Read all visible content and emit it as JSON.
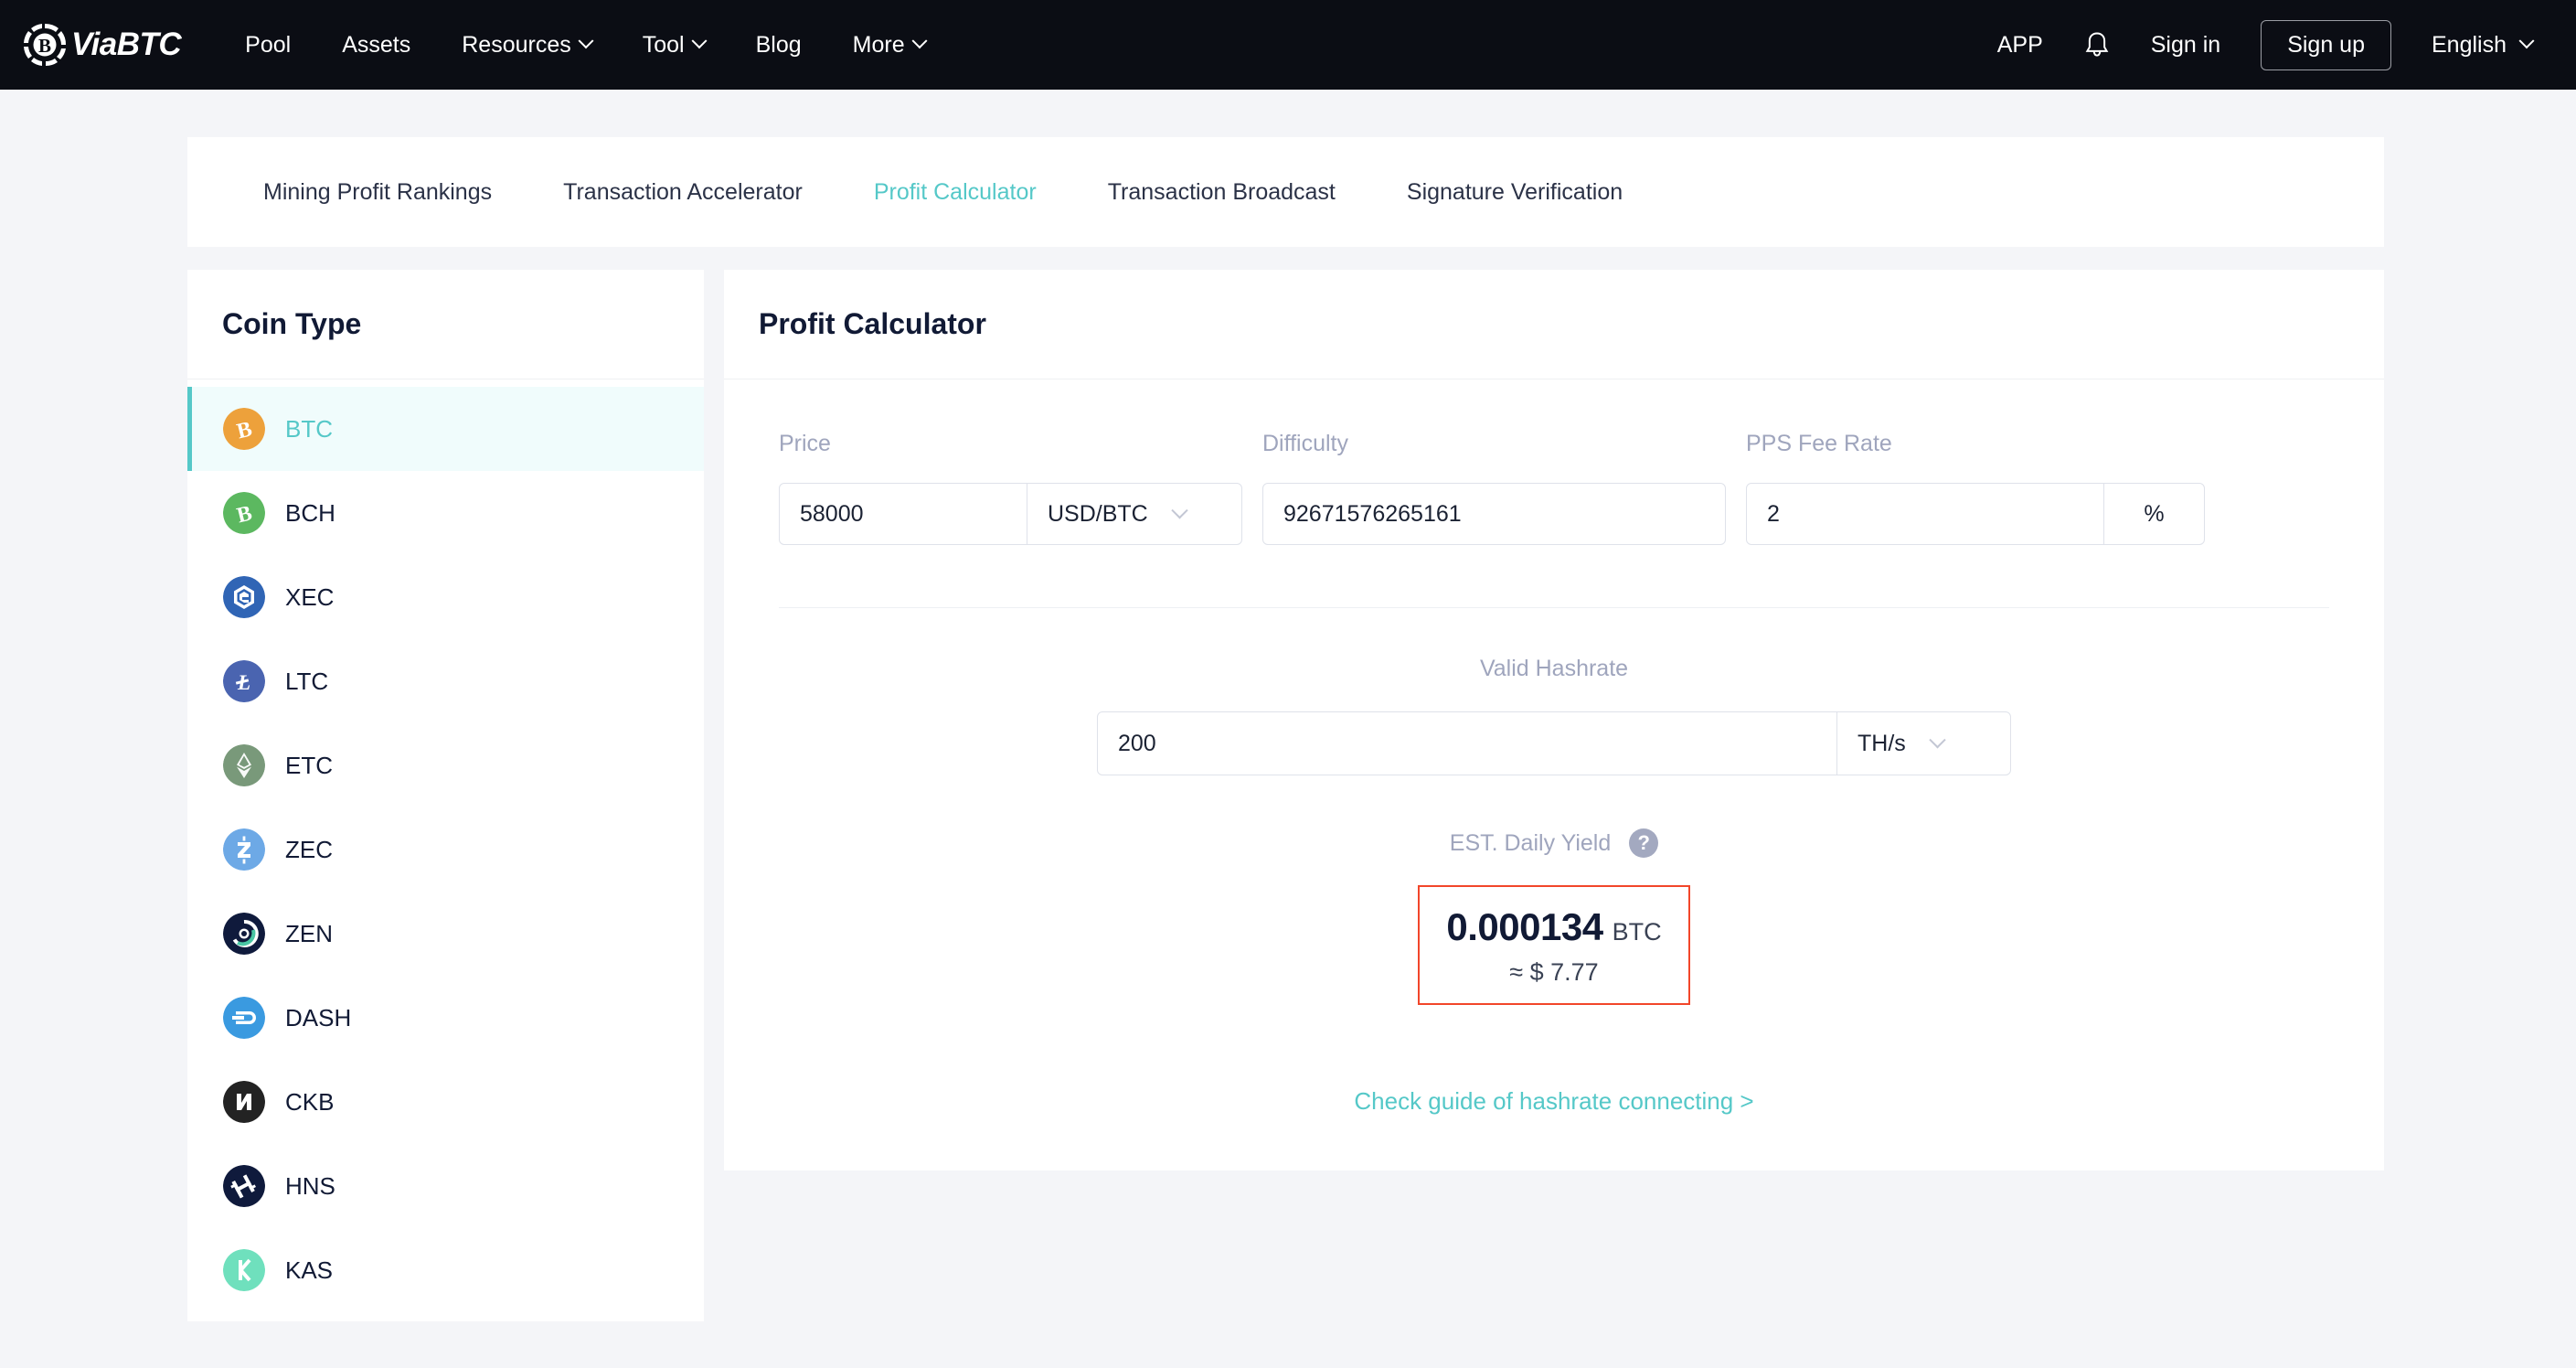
{
  "brand": {
    "name": "ViaBTC",
    "logo_icon": "bitcoin-circle-logo"
  },
  "nav": {
    "links": [
      {
        "label": "Pool",
        "has_chevron": false
      },
      {
        "label": "Assets",
        "has_chevron": false
      },
      {
        "label": "Resources",
        "has_chevron": true
      },
      {
        "label": "Tool",
        "has_chevron": true
      },
      {
        "label": "Blog",
        "has_chevron": false
      },
      {
        "label": "More",
        "has_chevron": true
      }
    ],
    "app_label": "APP",
    "bell_icon": "bell-icon",
    "sign_in": "Sign in",
    "sign_up": "Sign up",
    "language": "English"
  },
  "tabs": [
    {
      "label": "Mining Profit Rankings",
      "active": false
    },
    {
      "label": "Transaction Accelerator",
      "active": false
    },
    {
      "label": "Profit Calculator",
      "active": true
    },
    {
      "label": "Transaction Broadcast",
      "active": false
    },
    {
      "label": "Signature Verification",
      "active": false
    }
  ],
  "coin_panel": {
    "title": "Coin Type",
    "coins": [
      {
        "symbol": "BTC",
        "color": "#eda13b",
        "active": true,
        "icon": "btc-coin-icon"
      },
      {
        "symbol": "BCH",
        "color": "#5cb860",
        "active": false,
        "icon": "bch-coin-icon"
      },
      {
        "symbol": "XEC",
        "color": "#3065b5",
        "active": false,
        "icon": "xec-coin-icon"
      },
      {
        "symbol": "LTC",
        "color": "#4a64b0",
        "active": false,
        "icon": "ltc-coin-icon"
      },
      {
        "symbol": "ETC",
        "color": "#79997a",
        "active": false,
        "icon": "etc-coin-icon"
      },
      {
        "symbol": "ZEC",
        "color": "#6da9e6",
        "active": false,
        "icon": "zec-coin-icon"
      },
      {
        "symbol": "ZEN",
        "color": "#0f1a3c",
        "active": false,
        "icon": "zen-coin-icon"
      },
      {
        "symbol": "DASH",
        "color": "#3a9ae0",
        "active": false,
        "icon": "dash-coin-icon"
      },
      {
        "symbol": "CKB",
        "color": "#232323",
        "active": false,
        "icon": "ckb-coin-icon"
      },
      {
        "symbol": "HNS",
        "color": "#0f1a3c",
        "active": false,
        "icon": "hns-coin-icon"
      },
      {
        "symbol": "KAS",
        "color": "#6fe0bd",
        "active": false,
        "icon": "kas-coin-icon"
      }
    ]
  },
  "calculator": {
    "title": "Profit Calculator",
    "price": {
      "label": "Price",
      "value": "58000",
      "placeholder": "",
      "unit": "USD/BTC",
      "unit_icon": "chevron-down-icon"
    },
    "difficulty": {
      "label": "Difficulty",
      "value": "92671576265161",
      "placeholder": ""
    },
    "pps_fee_rate": {
      "label": "PPS Fee Rate",
      "value": "2",
      "placeholder": "",
      "unit": "%"
    },
    "valid_hashrate": {
      "label": "Valid Hashrate",
      "value": "200",
      "placeholder": "",
      "unit": "TH/s",
      "unit_icon": "chevron-down-icon"
    },
    "yield": {
      "label": "EST. Daily Yield",
      "help_icon": "question-mark-icon",
      "value": "0.000134",
      "unit": "BTC",
      "fiat": "≈ $ 7.77",
      "border_color": "#f2462a"
    },
    "guide_link": "Check guide of hashrate connecting >"
  },
  "theme": {
    "accent": "#55c8c8",
    "nav_bg": "#0b0d14",
    "page_bg": "#f4f5f8",
    "text_dark": "#111a35",
    "label_gray": "#9fa5bd"
  }
}
